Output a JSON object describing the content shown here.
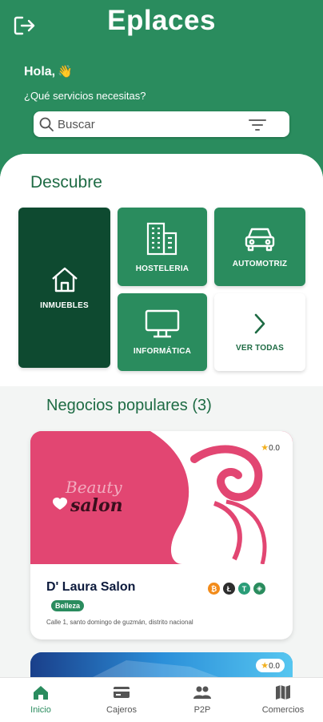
{
  "app": {
    "title": "Eplaces"
  },
  "header": {
    "greeting": "Hola,",
    "greeting_emoji": "👋",
    "question": "¿Qué servicios necesitas?",
    "search_placeholder": "Buscar"
  },
  "discover": {
    "title": "Descubre",
    "categories": [
      {
        "label": "INMUEBLES",
        "icon": "house-icon"
      },
      {
        "label": "HOSTELERIA",
        "icon": "building-icon"
      },
      {
        "label": "AUTOMOTRIZ",
        "icon": "car-icon"
      },
      {
        "label": "INFORMÁTICA",
        "icon": "monitor-icon"
      },
      {
        "label": "VER TODAS",
        "icon": "chevron-right-icon"
      }
    ]
  },
  "popular": {
    "title": "Negocios populares (3)",
    "businesses": [
      {
        "name": "D' Laura Salon",
        "category": "Belleza",
        "address": "Calle 1, santo domingo de guzmán, distrito nacional",
        "rating": "0.0",
        "image_text_1": "Beauty",
        "image_text_2": "salon",
        "payment_icons": [
          "bitcoin-icon",
          "litecoin-icon",
          "tether-icon",
          "crypto-icon"
        ]
      },
      {
        "rating": "0.0"
      }
    ]
  },
  "bottom_nav": {
    "items": [
      {
        "label": "Inicio",
        "icon": "home-icon",
        "active": true
      },
      {
        "label": "Cajeros",
        "icon": "card-icon",
        "active": false
      },
      {
        "label": "P2P",
        "icon": "users-icon",
        "active": false
      },
      {
        "label": "Comercios",
        "icon": "map-icon",
        "active": false
      }
    ]
  },
  "colors": {
    "primary": "#2a8c5e",
    "dark": "#0e4a30",
    "accent_title": "#1e6b44",
    "star": "#f2b01e"
  }
}
